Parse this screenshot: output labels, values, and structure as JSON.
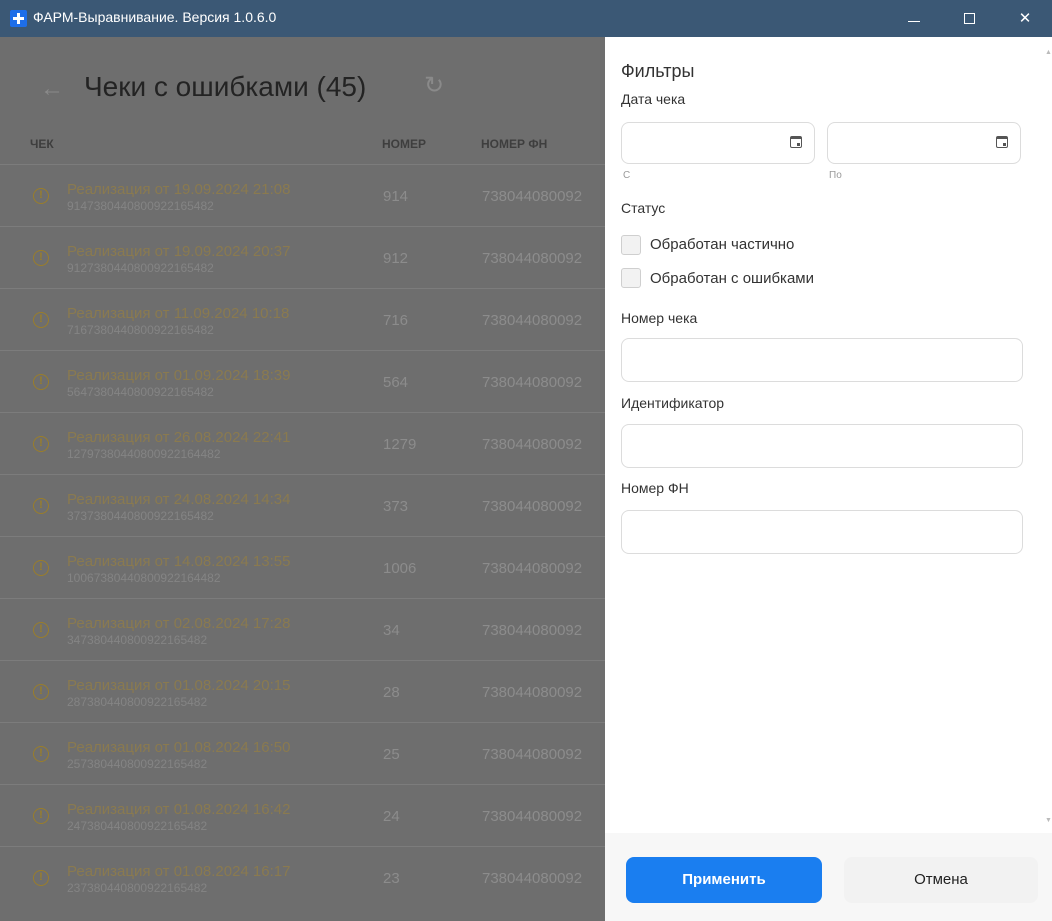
{
  "window": {
    "title": "ФАРМ-Выравнивание. Версия 1.0.6.0",
    "minimize": "—",
    "maximize": "☐",
    "close": "✕"
  },
  "main": {
    "back_icon": "←",
    "title": "Чеки с ошибками (45)",
    "refresh_icon": "↻",
    "columns": {
      "receipt": "ЧЕК",
      "number": "НОМЕР",
      "fn": "НОМЕР ФН"
    },
    "rows": [
      {
        "title": "Реализация от 19.09.2024 21:08",
        "id": "9147380440800922165482",
        "number": "914",
        "fn": "738044080092"
      },
      {
        "title": "Реализация от 19.09.2024 20:37",
        "id": "9127380440800922165482",
        "number": "912",
        "fn": "738044080092"
      },
      {
        "title": "Реализация от 11.09.2024 10:18",
        "id": "7167380440800922165482",
        "number": "716",
        "fn": "738044080092"
      },
      {
        "title": "Реализация от 01.09.2024 18:39",
        "id": "5647380440800922165482",
        "number": "564",
        "fn": "738044080092"
      },
      {
        "title": "Реализация от 26.08.2024 22:41",
        "id": "12797380440800922164482",
        "number": "1279",
        "fn": "738044080092"
      },
      {
        "title": "Реализация от 24.08.2024 14:34",
        "id": "3737380440800922165482",
        "number": "373",
        "fn": "738044080092"
      },
      {
        "title": "Реализация от 14.08.2024 13:55",
        "id": "10067380440800922164482",
        "number": "1006",
        "fn": "738044080092"
      },
      {
        "title": "Реализация от 02.08.2024 17:28",
        "id": "347380440800922165482",
        "number": "34",
        "fn": "738044080092"
      },
      {
        "title": "Реализация от 01.08.2024 20:15",
        "id": "287380440800922165482",
        "number": "28",
        "fn": "738044080092"
      },
      {
        "title": "Реализация от 01.08.2024 16:50",
        "id": "257380440800922165482",
        "number": "25",
        "fn": "738044080092"
      },
      {
        "title": "Реализация от 01.08.2024 16:42",
        "id": "247380440800922165482",
        "number": "24",
        "fn": "738044080092"
      },
      {
        "title": "Реализация от 01.08.2024 16:17",
        "id": "237380440800922165482",
        "number": "23",
        "fn": "738044080092"
      }
    ],
    "row_icon": "!"
  },
  "filters": {
    "title": "Фильтры",
    "date_label": "Дата чека",
    "date_from_label": "С",
    "date_to_label": "По",
    "date_from_value": "",
    "date_to_value": "",
    "status_label": "Статус",
    "status_options": [
      "Обработан частично",
      "Обработан с ошибками"
    ],
    "receipt_number_label": "Номер чека",
    "receipt_number_value": "",
    "identifier_label": "Идентификатор",
    "identifier_value": "",
    "fn_label": "Номер ФН",
    "fn_value": "",
    "apply_label": "Применить",
    "cancel_label": "Отмена"
  },
  "colors": {
    "accent": "#1a7ef0",
    "titlebar": "#3b5875",
    "warning": "#9a7e2a"
  },
  "icons": [
    "app-icon",
    "back-arrow-icon",
    "refresh-icon",
    "warning-icon",
    "calendar-icon",
    "minimize-icon",
    "maximize-icon",
    "close-icon"
  ]
}
